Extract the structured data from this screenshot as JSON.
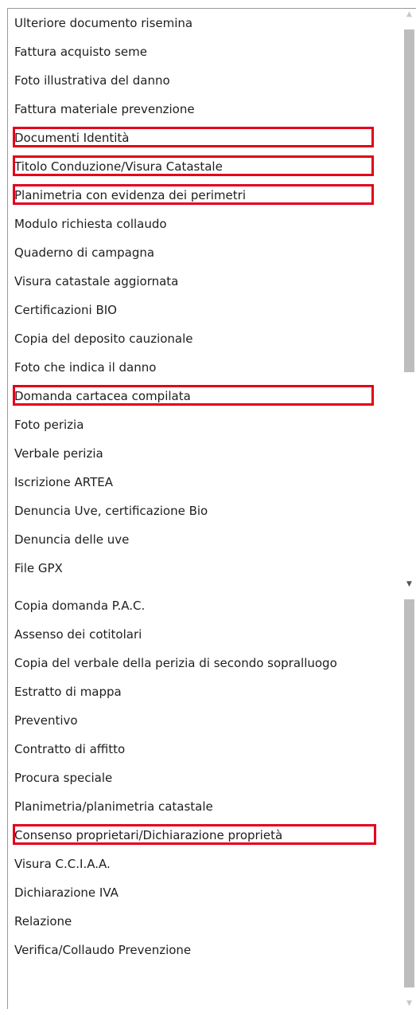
{
  "top_list": {
    "items": [
      {
        "label": "Ulteriore documento risemina",
        "highlighted": false
      },
      {
        "label": "Fattura acquisto seme",
        "highlighted": false
      },
      {
        "label": "Foto illustrativa del danno",
        "highlighted": false
      },
      {
        "label": "Fattura materiale prevenzione",
        "highlighted": false
      },
      {
        "label": "Documenti Identità",
        "highlighted": true
      },
      {
        "label": "Titolo Conduzione/Visura Catastale",
        "highlighted": true
      },
      {
        "label": "Planimetria con evidenza dei perimetri",
        "highlighted": true
      },
      {
        "label": "Modulo richiesta collaudo",
        "highlighted": false
      },
      {
        "label": "Quaderno di campagna",
        "highlighted": false
      },
      {
        "label": "Visura catastale aggiornata",
        "highlighted": false
      },
      {
        "label": "Certificazioni BIO",
        "highlighted": false
      },
      {
        "label": "Copia del deposito cauzionale",
        "highlighted": false
      },
      {
        "label": "Foto che indica il danno",
        "highlighted": false
      },
      {
        "label": "Domanda cartacea compilata",
        "highlighted": true
      },
      {
        "label": "Foto perizia",
        "highlighted": false
      },
      {
        "label": "Verbale perizia",
        "highlighted": false
      },
      {
        "label": "Iscrizione ARTEA",
        "highlighted": false
      },
      {
        "label": "Denuncia Uve, certificazione Bio",
        "highlighted": false
      },
      {
        "label": "Denuncia delle uve",
        "highlighted": false
      },
      {
        "label": "File GPX",
        "highlighted": false
      }
    ]
  },
  "bottom_list": {
    "items": [
      {
        "label": "Copia domanda P.A.C.",
        "highlighted": false
      },
      {
        "label": "Assenso dei cotitolari",
        "highlighted": false
      },
      {
        "label": "Copia del verbale della perizia di secondo sopralluogo",
        "highlighted": false
      },
      {
        "label": "Estratto di mappa",
        "highlighted": false
      },
      {
        "label": "Preventivo",
        "highlighted": false
      },
      {
        "label": "Contratto di affitto",
        "highlighted": false
      },
      {
        "label": "Procura speciale",
        "highlighted": false
      },
      {
        "label": "Planimetria/planimetria catastale",
        "highlighted": false
      },
      {
        "label": "Consenso proprietari/Dichiarazione proprietà",
        "highlighted": true
      },
      {
        "label": "Visura C.C.I.A.A.",
        "highlighted": false
      },
      {
        "label": "Dichiarazione IVA",
        "highlighted": false
      },
      {
        "label": "Relazione",
        "highlighted": false
      },
      {
        "label": "Verifica/Collaudo Prevenzione",
        "highlighted": false
      }
    ]
  },
  "scrollbar": {
    "up_arrow_icon": "▲",
    "down_arrow_icon": "▼"
  },
  "colors": {
    "highlight_border": "#e3001b",
    "text": "#1e1e1e",
    "scroll_thumb": "#bdbdbd"
  }
}
